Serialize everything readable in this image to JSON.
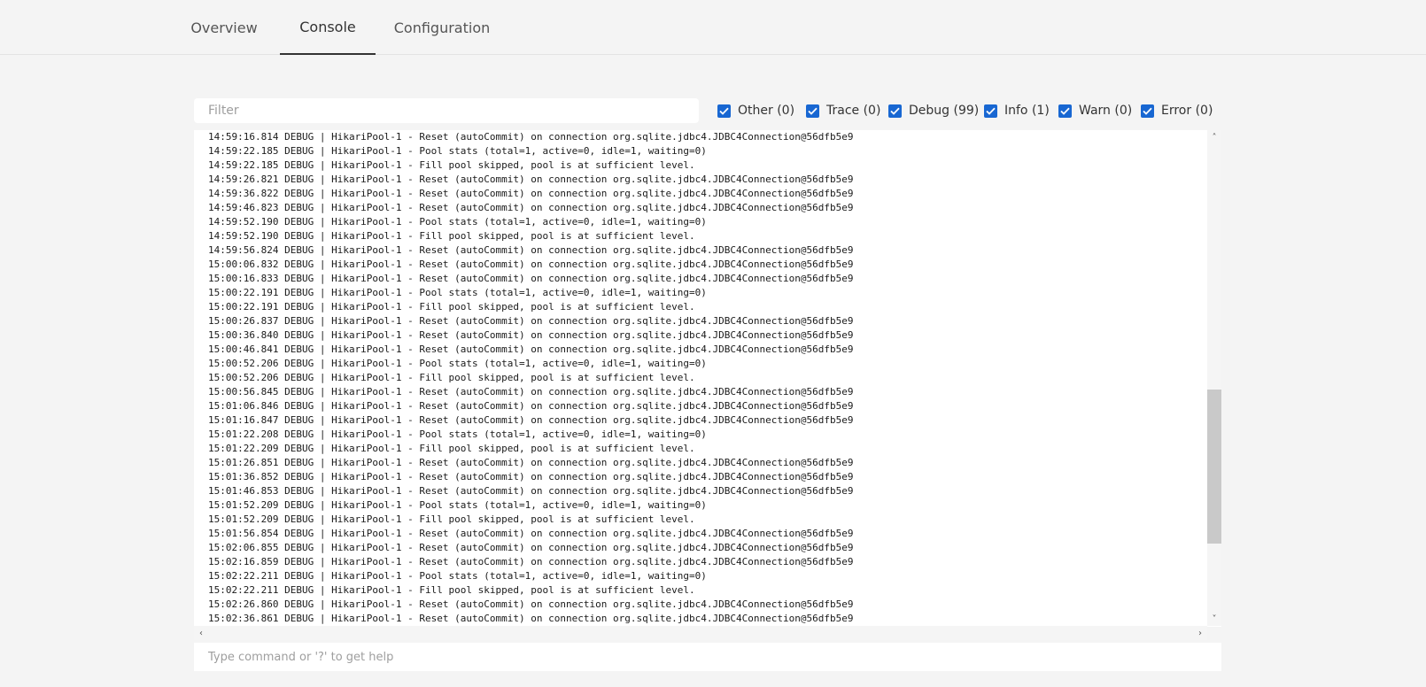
{
  "tabs": [
    {
      "label": "Overview",
      "active": false
    },
    {
      "label": "Console",
      "active": true
    },
    {
      "label": "Configuration",
      "active": false
    }
  ],
  "filter": {
    "placeholder": "Filter",
    "value": ""
  },
  "levels": [
    {
      "label": "Other (0)",
      "checked": true
    },
    {
      "label": "Trace (0)",
      "checked": true
    },
    {
      "label": "Debug (99)",
      "checked": true
    },
    {
      "label": "Info (1)",
      "checked": true
    },
    {
      "label": "Warn (0)",
      "checked": true
    },
    {
      "label": "Error (0)",
      "checked": true
    }
  ],
  "log_lines": [
    "14:59:16.814 DEBUG | HikariPool-1 - Reset (autoCommit) on connection org.sqlite.jdbc4.JDBC4Connection@56dfb5e9",
    "14:59:22.185 DEBUG | HikariPool-1 - Pool stats (total=1, active=0, idle=1, waiting=0)",
    "14:59:22.185 DEBUG | HikariPool-1 - Fill pool skipped, pool is at sufficient level.",
    "14:59:26.821 DEBUG | HikariPool-1 - Reset (autoCommit) on connection org.sqlite.jdbc4.JDBC4Connection@56dfb5e9",
    "14:59:36.822 DEBUG | HikariPool-1 - Reset (autoCommit) on connection org.sqlite.jdbc4.JDBC4Connection@56dfb5e9",
    "14:59:46.823 DEBUG | HikariPool-1 - Reset (autoCommit) on connection org.sqlite.jdbc4.JDBC4Connection@56dfb5e9",
    "14:59:52.190 DEBUG | HikariPool-1 - Pool stats (total=1, active=0, idle=1, waiting=0)",
    "14:59:52.190 DEBUG | HikariPool-1 - Fill pool skipped, pool is at sufficient level.",
    "14:59:56.824 DEBUG | HikariPool-1 - Reset (autoCommit) on connection org.sqlite.jdbc4.JDBC4Connection@56dfb5e9",
    "15:00:06.832 DEBUG | HikariPool-1 - Reset (autoCommit) on connection org.sqlite.jdbc4.JDBC4Connection@56dfb5e9",
    "15:00:16.833 DEBUG | HikariPool-1 - Reset (autoCommit) on connection org.sqlite.jdbc4.JDBC4Connection@56dfb5e9",
    "15:00:22.191 DEBUG | HikariPool-1 - Pool stats (total=1, active=0, idle=1, waiting=0)",
    "15:00:22.191 DEBUG | HikariPool-1 - Fill pool skipped, pool is at sufficient level.",
    "15:00:26.837 DEBUG | HikariPool-1 - Reset (autoCommit) on connection org.sqlite.jdbc4.JDBC4Connection@56dfb5e9",
    "15:00:36.840 DEBUG | HikariPool-1 - Reset (autoCommit) on connection org.sqlite.jdbc4.JDBC4Connection@56dfb5e9",
    "15:00:46.841 DEBUG | HikariPool-1 - Reset (autoCommit) on connection org.sqlite.jdbc4.JDBC4Connection@56dfb5e9",
    "15:00:52.206 DEBUG | HikariPool-1 - Pool stats (total=1, active=0, idle=1, waiting=0)",
    "15:00:52.206 DEBUG | HikariPool-1 - Fill pool skipped, pool is at sufficient level.",
    "15:00:56.845 DEBUG | HikariPool-1 - Reset (autoCommit) on connection org.sqlite.jdbc4.JDBC4Connection@56dfb5e9",
    "15:01:06.846 DEBUG | HikariPool-1 - Reset (autoCommit) on connection org.sqlite.jdbc4.JDBC4Connection@56dfb5e9",
    "15:01:16.847 DEBUG | HikariPool-1 - Reset (autoCommit) on connection org.sqlite.jdbc4.JDBC4Connection@56dfb5e9",
    "15:01:22.208 DEBUG | HikariPool-1 - Pool stats (total=1, active=0, idle=1, waiting=0)",
    "15:01:22.209 DEBUG | HikariPool-1 - Fill pool skipped, pool is at sufficient level.",
    "15:01:26.851 DEBUG | HikariPool-1 - Reset (autoCommit) on connection org.sqlite.jdbc4.JDBC4Connection@56dfb5e9",
    "15:01:36.852 DEBUG | HikariPool-1 - Reset (autoCommit) on connection org.sqlite.jdbc4.JDBC4Connection@56dfb5e9",
    "15:01:46.853 DEBUG | HikariPool-1 - Reset (autoCommit) on connection org.sqlite.jdbc4.JDBC4Connection@56dfb5e9",
    "15:01:52.209 DEBUG | HikariPool-1 - Pool stats (total=1, active=0, idle=1, waiting=0)",
    "15:01:52.209 DEBUG | HikariPool-1 - Fill pool skipped, pool is at sufficient level.",
    "15:01:56.854 DEBUG | HikariPool-1 - Reset (autoCommit) on connection org.sqlite.jdbc4.JDBC4Connection@56dfb5e9",
    "15:02:06.855 DEBUG | HikariPool-1 - Reset (autoCommit) on connection org.sqlite.jdbc4.JDBC4Connection@56dfb5e9",
    "15:02:16.859 DEBUG | HikariPool-1 - Reset (autoCommit) on connection org.sqlite.jdbc4.JDBC4Connection@56dfb5e9",
    "15:02:22.211 DEBUG | HikariPool-1 - Pool stats (total=1, active=0, idle=1, waiting=0)",
    "15:02:22.211 DEBUG | HikariPool-1 - Fill pool skipped, pool is at sufficient level.",
    "15:02:26.860 DEBUG | HikariPool-1 - Reset (autoCommit) on connection org.sqlite.jdbc4.JDBC4Connection@56dfb5e9",
    "15:02:36.861 DEBUG | HikariPool-1 - Reset (autoCommit) on connection org.sqlite.jdbc4.JDBC4Connection@56dfb5e9"
  ],
  "command": {
    "placeholder": "Type command or '?' to get help",
    "value": ""
  },
  "colors": {
    "accent": "#1867d2",
    "scroll_thumb": "#c9c9c9"
  },
  "icons": {
    "checkbox": "checkmark-icon",
    "scroll_up": "chevron-up-icon",
    "scroll_down": "chevron-down-icon",
    "scroll_left": "chevron-left-icon",
    "scroll_right": "chevron-right-icon"
  }
}
